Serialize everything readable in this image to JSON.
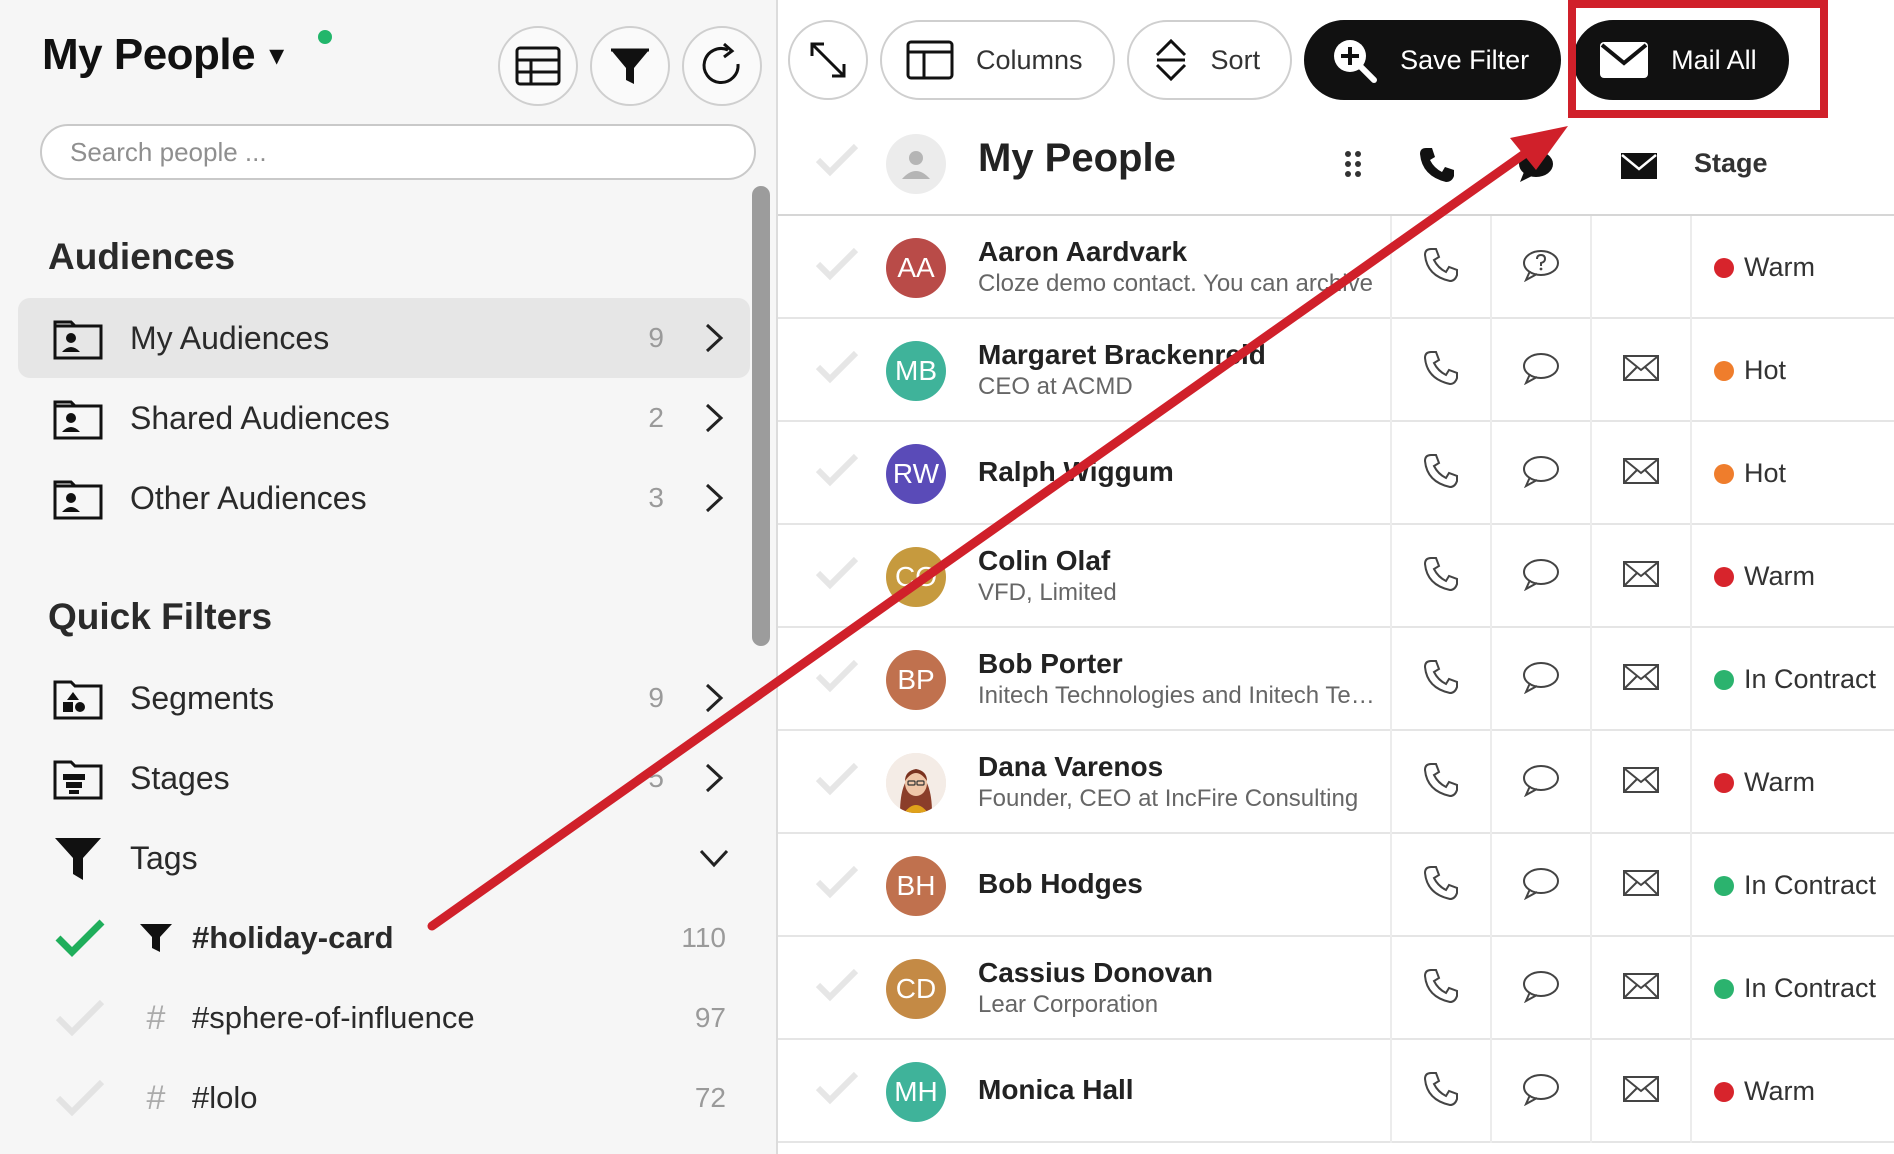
{
  "sidebar": {
    "title": "My People",
    "caret": "▾",
    "search_placeholder": "Search people ...",
    "audiences_title": "Audiences",
    "audiences": [
      {
        "label": "My Audiences",
        "count": "9"
      },
      {
        "label": "Shared Audiences",
        "count": "2"
      },
      {
        "label": "Other Audiences",
        "count": "3"
      }
    ],
    "quick_filters_title": "Quick Filters",
    "filters": [
      {
        "label": "Segments",
        "count": "9"
      },
      {
        "label": "Stages",
        "count": "5"
      },
      {
        "label": "Tags",
        "count": ""
      }
    ],
    "tags": [
      {
        "label": "#holiday-card",
        "count": "110",
        "selected": true
      },
      {
        "label": "#sphere-of-influence",
        "count": "97",
        "selected": false
      },
      {
        "label": "#lolo",
        "count": "72",
        "selected": false
      }
    ]
  },
  "toolbar": {
    "columns_label": "Columns",
    "sort_label": "Sort",
    "save_filter_label": "Save Filter",
    "mail_all_label": "Mail All"
  },
  "table": {
    "title": "My People",
    "stage_header": "Stage",
    "rows": [
      {
        "initials": "AA",
        "name": "Aaron Aardvark",
        "sub": "Cloze demo contact. You can archive",
        "stage": "Warm"
      },
      {
        "initials": "MB",
        "name": "Margaret Brackenreid",
        "sub": "CEO at ACMD",
        "stage": "Hot"
      },
      {
        "initials": "RW",
        "name": "Ralph Wiggum",
        "sub": "",
        "stage": "Hot"
      },
      {
        "initials": "CO",
        "name": "Colin Olaf",
        "sub": "VFD, Limited",
        "stage": "Warm"
      },
      {
        "initials": "BP",
        "name": "Bob Porter",
        "sub": "Initech Technologies and Initech Technologies",
        "stage": "In Contract"
      },
      {
        "initials": "",
        "name": "Dana Varenos",
        "sub": "Founder, CEO at IncFire Consulting",
        "stage": "Warm"
      },
      {
        "initials": "BH",
        "name": "Bob Hodges",
        "sub": "",
        "stage": "In Contract"
      },
      {
        "initials": "CD",
        "name": "Cassius Donovan",
        "sub": "Lear Corporation",
        "stage": "In Contract"
      },
      {
        "initials": "MH",
        "name": "Monica Hall",
        "sub": "",
        "stage": "Warm"
      }
    ]
  },
  "colors": {
    "warm": "#d7242c",
    "hot": "#ef7d2c",
    "in_contract": "#2bb36e",
    "annotation": "#d0202a",
    "avatar_aa": "#b94b48",
    "avatar_mb": "#3fb39a",
    "avatar_rw": "#5a4bb8",
    "avatar_co": "#c69a3e",
    "avatar_bp": "#c0714e",
    "avatar_bh": "#c0714e",
    "avatar_cd": "#c48a45",
    "avatar_mh": "#3fb39a"
  }
}
